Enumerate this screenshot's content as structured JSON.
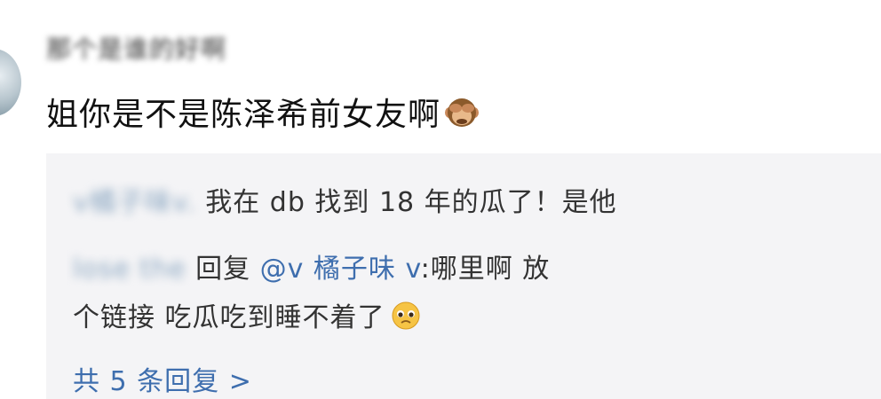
{
  "comment": {
    "username": "那个是谁的好啊",
    "text": "姐你是不是陈泽希前女友啊",
    "emoji": "see-no-evil-monkey"
  },
  "replies": [
    {
      "author": "v橘子味v.",
      "text": "我在 db 找到 18 年的瓜了！是他"
    },
    {
      "author": "lose the",
      "reply_word": "回复",
      "mention": "@v 橘子味 v",
      "text_line1": ":哪里啊 放",
      "text_line2": "个链接 吃瓜吃到睡不着了",
      "emoji": "pleading-face"
    }
  ],
  "more_replies": "共 5 条回复 >"
}
